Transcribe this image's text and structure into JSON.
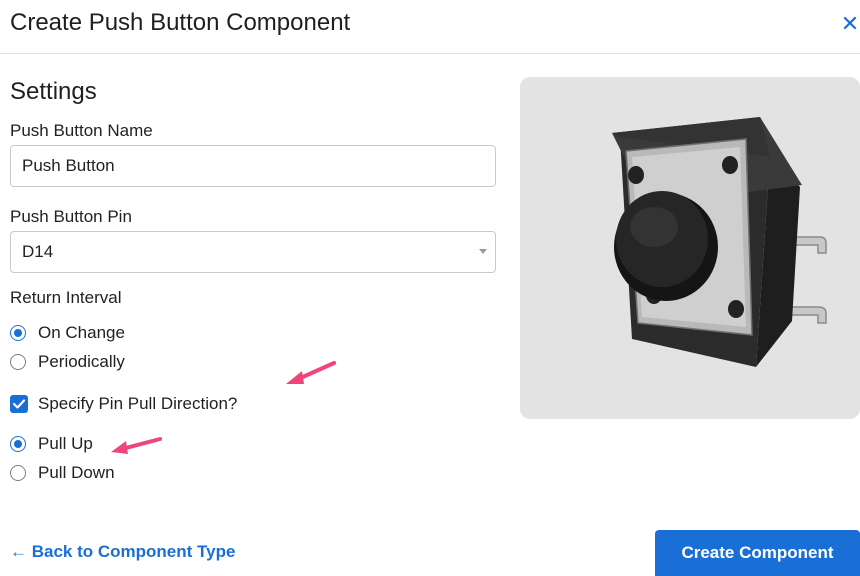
{
  "dialog": {
    "title": "Create Push Button Component",
    "close_glyph": "✕"
  },
  "settings": {
    "heading": "Settings",
    "name_label": "Push Button Name",
    "name_value": "Push Button",
    "pin_label": "Push Button Pin",
    "pin_value": "D14",
    "interval_label": "Return Interval",
    "interval_options": [
      {
        "label": "On Change",
        "selected": true
      },
      {
        "label": "Periodically",
        "selected": false
      }
    ],
    "pull_checkbox_label": "Specify Pin Pull Direction?",
    "pull_checkbox_checked": true,
    "pull_options": [
      {
        "label": "Pull Up",
        "selected": true
      },
      {
        "label": "Pull Down",
        "selected": false
      }
    ]
  },
  "footer": {
    "back_label": "← Back to Component Type",
    "create_label": "Create Component"
  },
  "image": {
    "icon": "push-button-product-icon"
  },
  "colors": {
    "accent": "#1a6fd6",
    "annotation": "#f0457a",
    "image_bg": "#e3e3e3"
  }
}
